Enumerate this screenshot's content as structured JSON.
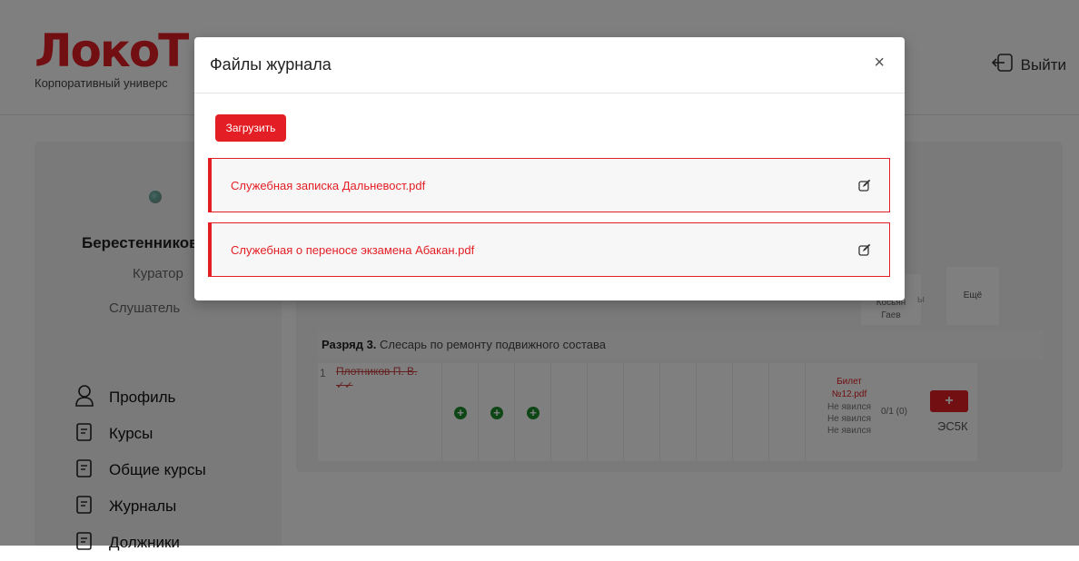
{
  "brand": {
    "logo_text": "ЛокоТ",
    "tagline": "Корпоративный универс"
  },
  "header": {
    "logout_label": "Выйти"
  },
  "sidebar": {
    "user_name": "Берестенников",
    "roles": [
      "Куратор",
      "Слушатель"
    ],
    "menu": [
      {
        "label": "Профиль",
        "icon": "user-icon"
      },
      {
        "label": "Курсы",
        "icon": "book-icon"
      },
      {
        "label": "Общие курсы",
        "icon": "book-icon"
      },
      {
        "label": "Журналы",
        "icon": "book-icon"
      },
      {
        "label": "Должники",
        "icon": "book-icon"
      }
    ]
  },
  "journal": {
    "header": {
      "examiner_1": "Косьян",
      "examiner_2": "Гаев",
      "col_fragment": "ы",
      "more_label": "Ещё"
    },
    "grade_bold": "Разряд 3.",
    "grade_text": " Слесарь по ремонту подвижного состава",
    "row": {
      "number": "1",
      "name": "Плотников П. В.",
      "name_extra": "✓✓",
      "ticket_link": "Билет №12.pdf",
      "statuses": [
        "Не явился",
        "Не явился",
        "Не явился"
      ],
      "score": "0/1 (0)",
      "category": "ЭС5К"
    }
  },
  "modal": {
    "title": "Файлы журнала",
    "close_symbol": "×",
    "upload_label": "Загрузить",
    "files": [
      {
        "name": "Служебная записка Дальневост.pdf"
      },
      {
        "name": "Служебная о переносе экзамена Абакан.pdf"
      }
    ]
  },
  "colors": {
    "accent": "#e31e24",
    "success": "#1e8c2a",
    "overlay": "rgba(0,0,0,0.5)"
  }
}
